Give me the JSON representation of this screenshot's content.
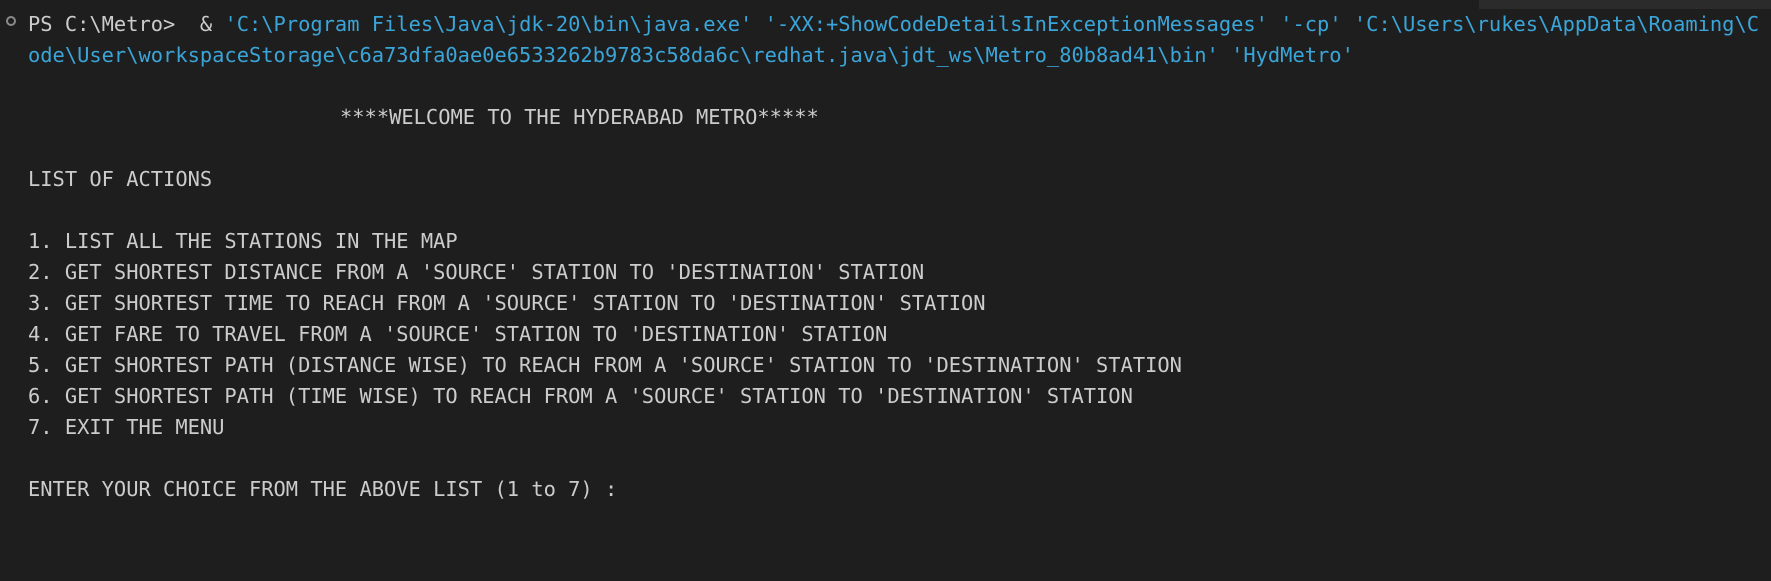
{
  "terminal": {
    "prompt": "PS C:\\Metro> ",
    "operator": " & ",
    "args": [
      "'C:\\Program Files\\Java\\jdk-20\\bin\\java.exe'",
      "'-XX:+ShowCodeDetailsInExceptionMessages'",
      "'-cp'",
      "'C:\\Users\\rukes\\AppData\\Roaming\\Code\\User\\workspaceStorage\\c6a73dfa0ae0e6533262b9783c58da6c\\redhat.java\\jdt_ws\\Metro_80b8ad41\\bin'",
      "'HydMetro'"
    ],
    "banner": "****WELCOME TO THE HYDERABAD METRO*****",
    "list_heading": "LIST OF ACTIONS",
    "actions": [
      "1. LIST ALL THE STATIONS IN THE MAP",
      "2. GET SHORTEST DISTANCE FROM A 'SOURCE' STATION TO 'DESTINATION' STATION",
      "3. GET SHORTEST TIME TO REACH FROM A 'SOURCE' STATION TO 'DESTINATION' STATION",
      "4. GET FARE TO TRAVEL FROM A 'SOURCE' STATION TO 'DESTINATION' STATION",
      "5. GET SHORTEST PATH (DISTANCE WISE) TO REACH FROM A 'SOURCE' STATION TO 'DESTINATION' STATION",
      "6. GET SHORTEST PATH (TIME WISE) TO REACH FROM A 'SOURCE' STATION TO 'DESTINATION' STATION",
      "7. EXIT THE MENU"
    ],
    "input_prompt": "ENTER YOUR CHOICE FROM THE ABOVE LIST (1 to 7) : "
  },
  "colors": {
    "background": "#1e1e1e",
    "text": "#cccccc",
    "string": "#3aa5d8"
  },
  "icons": {
    "command_decorator": "circle-outline-icon"
  }
}
